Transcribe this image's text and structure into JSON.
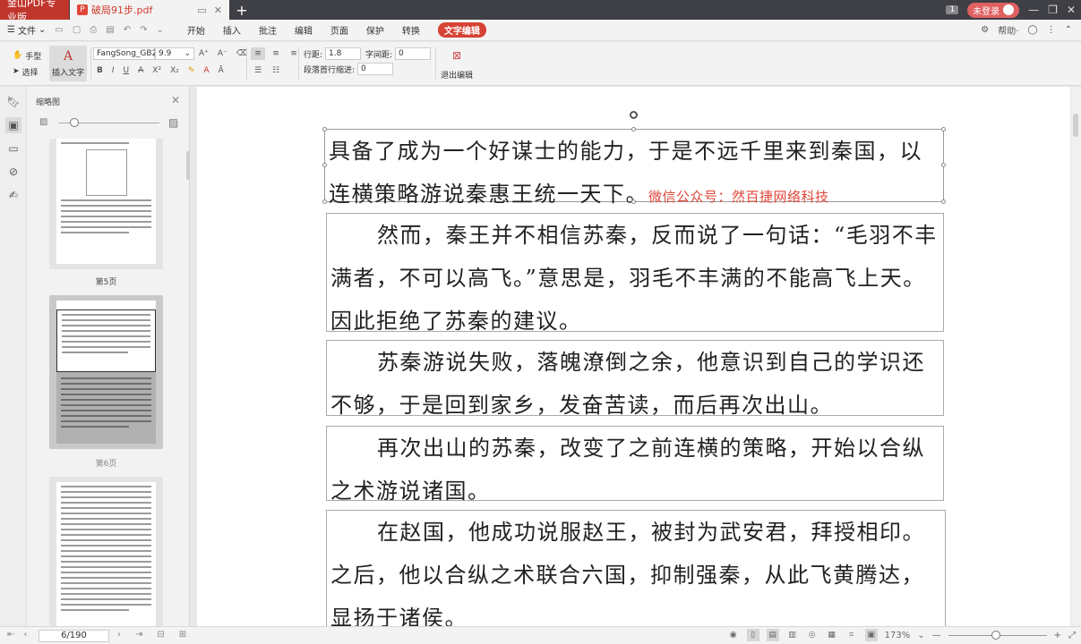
{
  "titlebar": {
    "app_tab": "金山PDF专业版",
    "doc_tab": "破局91步.pdf",
    "new_tab": "+",
    "kbd_badge": "1",
    "login": "未登录"
  },
  "menubar": {
    "file": "文件",
    "items": [
      "开始",
      "插入",
      "批注",
      "编辑",
      "页面",
      "保护",
      "转换",
      "文字编辑"
    ],
    "help": "帮助·"
  },
  "ribbon": {
    "hand": "手型",
    "select": "选择",
    "insert_text_glyph": "A",
    "insert_text": "插入文字",
    "font_name": "FangSong_GB2",
    "font_size": "9.9",
    "line_spacing_label": "行距:",
    "line_spacing_value": "1.8",
    "char_spacing_label": "字间距:",
    "char_spacing_value": "0",
    "indent_label": "段落首行缩进:",
    "indent_value": "0",
    "exit_edit": "退出编辑"
  },
  "thumbpanel": {
    "title": "缩略图",
    "pages": [
      {
        "label": "第5页"
      },
      {
        "label": "第6页"
      },
      {
        "label": ""
      }
    ]
  },
  "document": {
    "paragraphs": [
      {
        "text": "具备了成为一个好谋士的能力，于是不远千里来到秦国，以连横策略游说秦惠王统一天下。",
        "note": "微信公众号：然百捷网络科技"
      },
      {
        "text": "然而，秦王并不相信苏秦，反而说了一句话：“毛羽不丰满者，不可以高飞。”意思是，羽毛不丰满的不能高飞上天。因此拒绝了苏秦的建议。"
      },
      {
        "text": "苏秦游说失败，落魄潦倒之余，他意识到自己的学识还不够，于是回到家乡，发奋苦读，而后再次出山。"
      },
      {
        "text": "再次出山的苏秦，改变了之前连横的策略，开始以合纵之术游说诸国。"
      },
      {
        "text": "在赵国，他成功说服赵王，被封为武安君，拜授相印。之后，他以合纵之术联合六国，抑制强秦，从此飞黄腾达，显扬于诸侯。"
      }
    ]
  },
  "statusbar": {
    "page": "6/190",
    "zoom": "173%"
  },
  "colors": {
    "brand_red": "#c0362c",
    "accent_red": "#e0463a"
  }
}
